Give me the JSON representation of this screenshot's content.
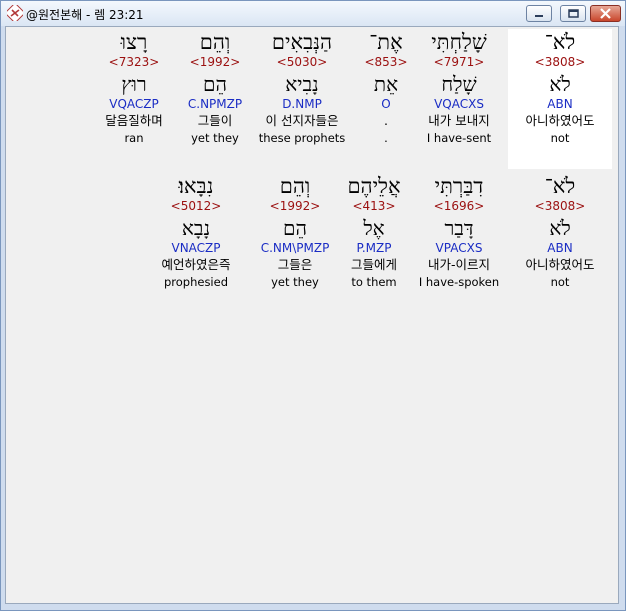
{
  "window": {
    "title": "@원전본해 - 렘 23:21"
  },
  "verse_line1": [
    {
      "hebrew": "לֹא־",
      "strongs": "<3808>",
      "lemma": "לֹא",
      "morph": "ABN",
      "korean": "아니하였어도",
      "english": "not"
    },
    {
      "hebrew": "שָׁלַחְתִּי",
      "strongs": "<7971>",
      "lemma": "שָׁלַח",
      "morph": "VQACXS",
      "korean": "내가 보내지",
      "english": "I have-sent"
    },
    {
      "hebrew": "אֶת־",
      "strongs": "<853>",
      "lemma": "אֵת",
      "morph": "O",
      "korean": ".",
      "english": "."
    },
    {
      "hebrew": "הַנְּבִאִים",
      "strongs": "<5030>",
      "lemma": "נָבִיא",
      "morph": "D.NMP",
      "korean": "이 선지자들은",
      "english": "these prophets"
    },
    {
      "hebrew": "וְהֵם",
      "strongs": "<1992>",
      "lemma": "הֵם",
      "morph": "C.NPMZP",
      "korean": "그들이",
      "english": "yet they"
    },
    {
      "hebrew": "רָצוּ",
      "strongs": "<7323>",
      "lemma": "רוּץ",
      "morph": "VQACZP",
      "korean": "달음질하며",
      "english": "ran"
    }
  ],
  "verse_line2": [
    {
      "hebrew": "לֹא־",
      "strongs": "<3808>",
      "lemma": "לֹא",
      "morph": "ABN",
      "korean": "아니하였어도",
      "english": "not"
    },
    {
      "hebrew": "דִבַּרְתִּי",
      "strongs": "<1696>",
      "lemma": "דָּבַר",
      "morph": "VPACXS",
      "korean": "내가-이르지",
      "english": "I have-spoken"
    },
    {
      "hebrew": "אֲלֵיהֶם",
      "strongs": "<413>",
      "lemma": "אֶל",
      "morph": "P.MZP",
      "korean": "그들에게",
      "english": "to them"
    },
    {
      "hebrew": "וְהֵם",
      "strongs": "<1992>",
      "lemma": "הֵם",
      "morph": "C.NM\\PMZP",
      "korean": "그들은",
      "english": "yet they"
    },
    {
      "hebrew": "נִבָּאוּ׃",
      "strongs": "<5012>",
      "lemma": "נָבָא",
      "morph": "VNACZP",
      "korean": "예언하였은즉",
      "english": "prophesied"
    }
  ],
  "colors": {
    "strongs": "#9b1010",
    "morph": "#1a2cc4",
    "selected_bg": "#ffffff"
  },
  "icons": [
    "app-icon",
    "minimize-icon",
    "maximize-icon",
    "close-icon"
  ]
}
